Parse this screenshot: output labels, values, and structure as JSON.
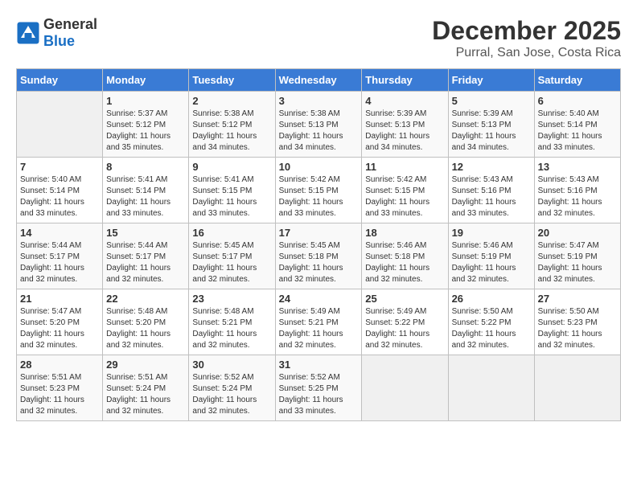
{
  "header": {
    "logo_general": "General",
    "logo_blue": "Blue",
    "month_title": "December 2025",
    "location": "Purral, San Jose, Costa Rica"
  },
  "days_of_week": [
    "Sunday",
    "Monday",
    "Tuesday",
    "Wednesday",
    "Thursday",
    "Friday",
    "Saturday"
  ],
  "weeks": [
    [
      {
        "day": "",
        "info": ""
      },
      {
        "day": "1",
        "info": "Sunrise: 5:37 AM\nSunset: 5:12 PM\nDaylight: 11 hours\nand 35 minutes."
      },
      {
        "day": "2",
        "info": "Sunrise: 5:38 AM\nSunset: 5:12 PM\nDaylight: 11 hours\nand 34 minutes."
      },
      {
        "day": "3",
        "info": "Sunrise: 5:38 AM\nSunset: 5:13 PM\nDaylight: 11 hours\nand 34 minutes."
      },
      {
        "day": "4",
        "info": "Sunrise: 5:39 AM\nSunset: 5:13 PM\nDaylight: 11 hours\nand 34 minutes."
      },
      {
        "day": "5",
        "info": "Sunrise: 5:39 AM\nSunset: 5:13 PM\nDaylight: 11 hours\nand 34 minutes."
      },
      {
        "day": "6",
        "info": "Sunrise: 5:40 AM\nSunset: 5:14 PM\nDaylight: 11 hours\nand 33 minutes."
      }
    ],
    [
      {
        "day": "7",
        "info": "Sunrise: 5:40 AM\nSunset: 5:14 PM\nDaylight: 11 hours\nand 33 minutes."
      },
      {
        "day": "8",
        "info": "Sunrise: 5:41 AM\nSunset: 5:14 PM\nDaylight: 11 hours\nand 33 minutes."
      },
      {
        "day": "9",
        "info": "Sunrise: 5:41 AM\nSunset: 5:15 PM\nDaylight: 11 hours\nand 33 minutes."
      },
      {
        "day": "10",
        "info": "Sunrise: 5:42 AM\nSunset: 5:15 PM\nDaylight: 11 hours\nand 33 minutes."
      },
      {
        "day": "11",
        "info": "Sunrise: 5:42 AM\nSunset: 5:15 PM\nDaylight: 11 hours\nand 33 minutes."
      },
      {
        "day": "12",
        "info": "Sunrise: 5:43 AM\nSunset: 5:16 PM\nDaylight: 11 hours\nand 33 minutes."
      },
      {
        "day": "13",
        "info": "Sunrise: 5:43 AM\nSunset: 5:16 PM\nDaylight: 11 hours\nand 32 minutes."
      }
    ],
    [
      {
        "day": "14",
        "info": "Sunrise: 5:44 AM\nSunset: 5:17 PM\nDaylight: 11 hours\nand 32 minutes."
      },
      {
        "day": "15",
        "info": "Sunrise: 5:44 AM\nSunset: 5:17 PM\nDaylight: 11 hours\nand 32 minutes."
      },
      {
        "day": "16",
        "info": "Sunrise: 5:45 AM\nSunset: 5:17 PM\nDaylight: 11 hours\nand 32 minutes."
      },
      {
        "day": "17",
        "info": "Sunrise: 5:45 AM\nSunset: 5:18 PM\nDaylight: 11 hours\nand 32 minutes."
      },
      {
        "day": "18",
        "info": "Sunrise: 5:46 AM\nSunset: 5:18 PM\nDaylight: 11 hours\nand 32 minutes."
      },
      {
        "day": "19",
        "info": "Sunrise: 5:46 AM\nSunset: 5:19 PM\nDaylight: 11 hours\nand 32 minutes."
      },
      {
        "day": "20",
        "info": "Sunrise: 5:47 AM\nSunset: 5:19 PM\nDaylight: 11 hours\nand 32 minutes."
      }
    ],
    [
      {
        "day": "21",
        "info": "Sunrise: 5:47 AM\nSunset: 5:20 PM\nDaylight: 11 hours\nand 32 minutes."
      },
      {
        "day": "22",
        "info": "Sunrise: 5:48 AM\nSunset: 5:20 PM\nDaylight: 11 hours\nand 32 minutes."
      },
      {
        "day": "23",
        "info": "Sunrise: 5:48 AM\nSunset: 5:21 PM\nDaylight: 11 hours\nand 32 minutes."
      },
      {
        "day": "24",
        "info": "Sunrise: 5:49 AM\nSunset: 5:21 PM\nDaylight: 11 hours\nand 32 minutes."
      },
      {
        "day": "25",
        "info": "Sunrise: 5:49 AM\nSunset: 5:22 PM\nDaylight: 11 hours\nand 32 minutes."
      },
      {
        "day": "26",
        "info": "Sunrise: 5:50 AM\nSunset: 5:22 PM\nDaylight: 11 hours\nand 32 minutes."
      },
      {
        "day": "27",
        "info": "Sunrise: 5:50 AM\nSunset: 5:23 PM\nDaylight: 11 hours\nand 32 minutes."
      }
    ],
    [
      {
        "day": "28",
        "info": "Sunrise: 5:51 AM\nSunset: 5:23 PM\nDaylight: 11 hours\nand 32 minutes."
      },
      {
        "day": "29",
        "info": "Sunrise: 5:51 AM\nSunset: 5:24 PM\nDaylight: 11 hours\nand 32 minutes."
      },
      {
        "day": "30",
        "info": "Sunrise: 5:52 AM\nSunset: 5:24 PM\nDaylight: 11 hours\nand 32 minutes."
      },
      {
        "day": "31",
        "info": "Sunrise: 5:52 AM\nSunset: 5:25 PM\nDaylight: 11 hours\nand 33 minutes."
      },
      {
        "day": "",
        "info": ""
      },
      {
        "day": "",
        "info": ""
      },
      {
        "day": "",
        "info": ""
      }
    ]
  ]
}
